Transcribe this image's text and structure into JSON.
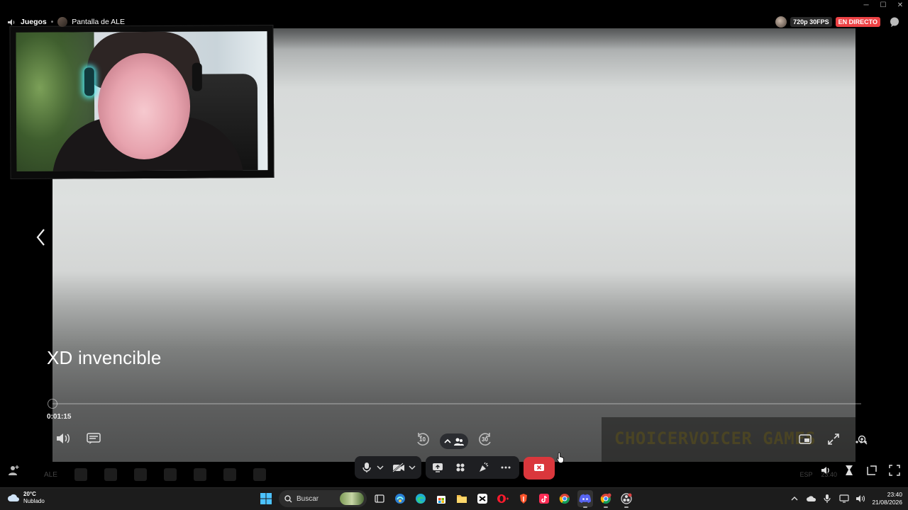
{
  "window": {
    "minimize": "─",
    "maximize": "☐",
    "close": "✕"
  },
  "header": {
    "category": "Juegos",
    "screen_label": "Pantalla de ALE",
    "quality_badge": "720p 30FPS",
    "live_badge": "EN DIRECTO"
  },
  "stream": {
    "caption": "XD invencible",
    "timecode": "0:01:15",
    "progress_fraction": 0.0,
    "rewind_seconds": "10",
    "forward_seconds": "30",
    "watermark": "CHOICERVOICER GAMES"
  },
  "taskbar_ghost": {
    "label": "ALE"
  },
  "tray_ghost": {
    "lang": "ESP",
    "time": "23:40",
    "date": "21/08/2026"
  },
  "taskbar": {
    "weather_temp": "20°C",
    "weather_desc": "Nublado",
    "search_placeholder": "Buscar",
    "clock_time": "23:40",
    "clock_date": "21/08/2026",
    "icons": [
      "start-icon",
      "search-icon",
      "task-view-icon",
      "widgets-icon",
      "edge-icon",
      "store-icon",
      "file-explorer-icon",
      "capcut-icon",
      "opera-icon",
      "brave-icon",
      "tiktok-icon",
      "chrome-icon",
      "discord-icon",
      "chrome-profile-icon",
      "obs-icon"
    ]
  },
  "colors": {
    "live": "#ed4245",
    "hangup": "#da373c",
    "accent": "#5865f2"
  }
}
